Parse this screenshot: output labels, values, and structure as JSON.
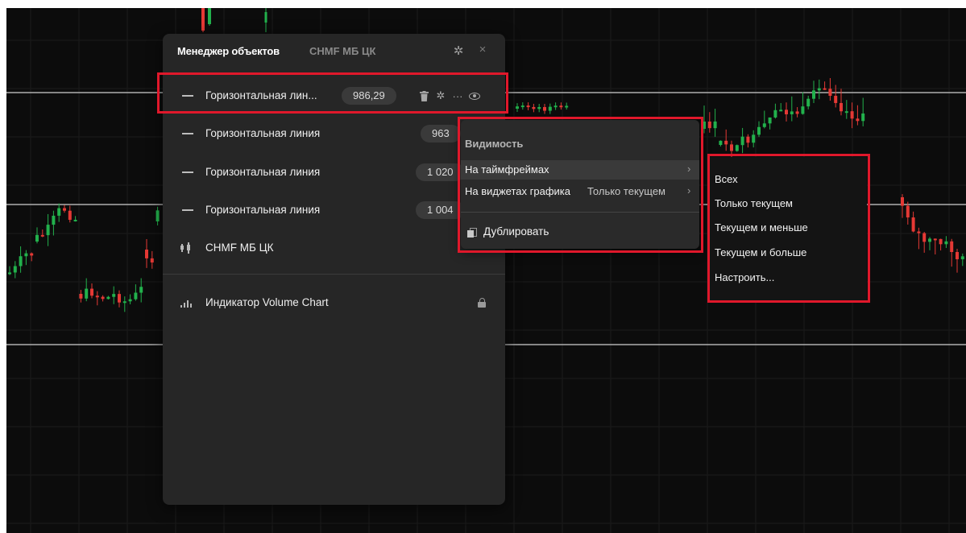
{
  "panel": {
    "title": "Менеджер объектов",
    "symbol": "CHMF МБ ЦК",
    "rows": [
      {
        "label": "Горизонтальная лин...",
        "value": "986,29"
      },
      {
        "label": "Горизонтальная линия",
        "value": "963"
      },
      {
        "label": "Горизонтальная линия",
        "value": "1 020"
      },
      {
        "label": "Горизонтальная линия",
        "value": "1 004"
      }
    ],
    "instrument": {
      "label": "CHMF МБ ЦК"
    },
    "indicator": {
      "label": "Индикатор Volume Chart"
    }
  },
  "menu": {
    "header": "Видимость",
    "items": [
      {
        "label": "На таймфреймах",
        "value": ""
      },
      {
        "label": "На виджетах графика",
        "value": "Только текущем"
      }
    ],
    "duplicate": "Дублировать"
  },
  "submenu": {
    "items": [
      "Всех",
      "Только текущем",
      "Текущем и меньше",
      "Текущем и больше",
      "Настроить..."
    ]
  },
  "colors": {
    "accent_highlight": "#e0182b",
    "bull": "#22b14c",
    "bear": "#e53935"
  },
  "icons": [
    "gear-icon",
    "close-icon",
    "trash-icon",
    "more-icon",
    "eye-icon",
    "lock-icon",
    "chevron-right-icon",
    "duplicate-icon",
    "candles-icon",
    "volume-icon"
  ]
}
